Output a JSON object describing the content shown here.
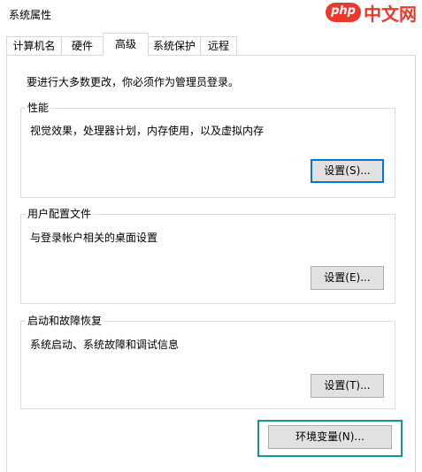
{
  "window": {
    "title": "系统属性"
  },
  "watermark": {
    "logo": "php",
    "text": "中文网"
  },
  "tabs": [
    {
      "label": "计算机名"
    },
    {
      "label": "硬件"
    },
    {
      "label": "高级"
    },
    {
      "label": "系统保护"
    },
    {
      "label": "远程"
    }
  ],
  "active_tab": "高级",
  "intro_text": "要进行大多数更改，你必须作为管理员登录。",
  "groups": {
    "performance": {
      "title": "性能",
      "description": "视觉效果，处理器计划，内存使用，以及虚拟内存",
      "button": "设置(S)..."
    },
    "user_profiles": {
      "title": "用户配置文件",
      "description": "与登录帐户相关的桌面设置",
      "button": "设置(E)..."
    },
    "startup_recovery": {
      "title": "启动和故障恢复",
      "description": "系统启动、系统故障和调试信息",
      "button": "设置(T)..."
    }
  },
  "env_button": "环境变量(N)...",
  "colors": {
    "highlight_frame": "#12968e",
    "focus_border": "#0078d7",
    "watermark": "#e8392c"
  }
}
